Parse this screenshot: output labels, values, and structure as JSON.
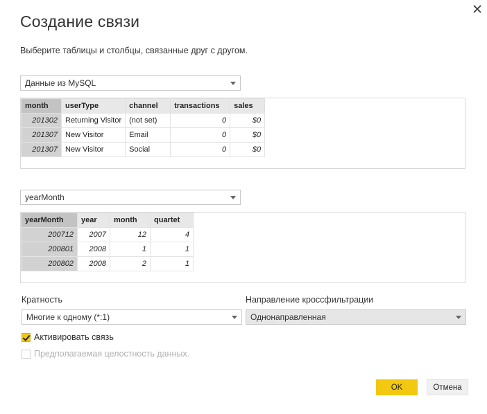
{
  "dialog": {
    "title": "Создание связи",
    "subtitle": "Выберите таблицы и столбцы, связанные друг с другом."
  },
  "table1": {
    "selected": "Данные из MySQL",
    "columns": [
      "month",
      "userType",
      "channel",
      "transactions",
      "sales"
    ],
    "rows": [
      [
        "201302",
        "Returning Visitor",
        "(not set)",
        "0",
        "$0"
      ],
      [
        "201307",
        "New Visitor",
        "Email",
        "0",
        "$0"
      ],
      [
        "201307",
        "New Visitor",
        "Social",
        "0",
        "$0"
      ]
    ]
  },
  "table2": {
    "selected": "yearMonth",
    "columns": [
      "yearMonth",
      "year",
      "month",
      "quartet"
    ],
    "rows": [
      [
        "200712",
        "2007",
        "12",
        "4"
      ],
      [
        "200801",
        "2008",
        "1",
        "1"
      ],
      [
        "200802",
        "2008",
        "2",
        "1"
      ]
    ]
  },
  "cardinality": {
    "label": "Кратность",
    "value": "Многие к одному (*:1)"
  },
  "crossfilter": {
    "label": "Направление кроссфильтрации",
    "value": "Однонаправленная"
  },
  "options": {
    "activate_label": "Активировать связь",
    "activate_checked": true,
    "integrity_label": "Предполагаемая целостность данных.",
    "integrity_checked": false
  },
  "buttons": {
    "ok": "OK",
    "cancel": "Отмена"
  },
  "colors": {
    "accent": "#f2c811",
    "selected_column": "#c3c3c3"
  }
}
